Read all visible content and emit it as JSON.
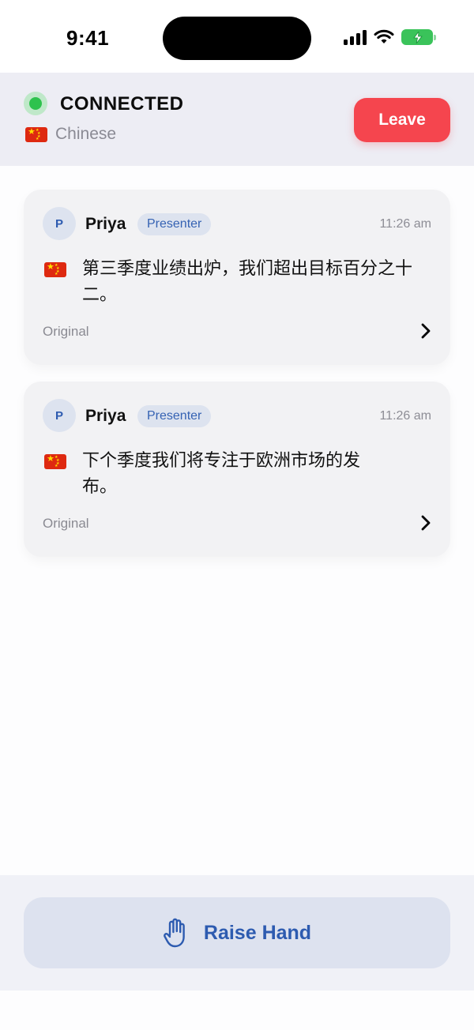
{
  "status_bar": {
    "time": "9:41"
  },
  "header": {
    "status": "CONNECTED",
    "language": "Chinese",
    "leave_label": "Leave"
  },
  "messages": [
    {
      "avatar_initial": "P",
      "speaker": "Priya",
      "role": "Presenter",
      "time": "11:26 am",
      "text": "第三季度业绩出炉，我们超出目标百分之十二。",
      "original_label": "Original"
    },
    {
      "avatar_initial": "P",
      "speaker": "Priya",
      "role": "Presenter",
      "time": "11:26 am",
      "text": "下个季度我们将专注于欧洲市场的发布。",
      "original_label": "Original"
    }
  ],
  "footer": {
    "raise_hand_label": "Raise Hand"
  },
  "colors": {
    "connected_dot": "#2ec24e",
    "leave_button": "#f5454e",
    "accent_blue": "#2d5bb0",
    "badge_bg": "#dde3ef"
  },
  "icons": [
    "cellular-signal-icon",
    "wifi-icon",
    "battery-charging-icon",
    "china-flag-icon",
    "chevron-right-icon",
    "raised-hand-icon"
  ]
}
